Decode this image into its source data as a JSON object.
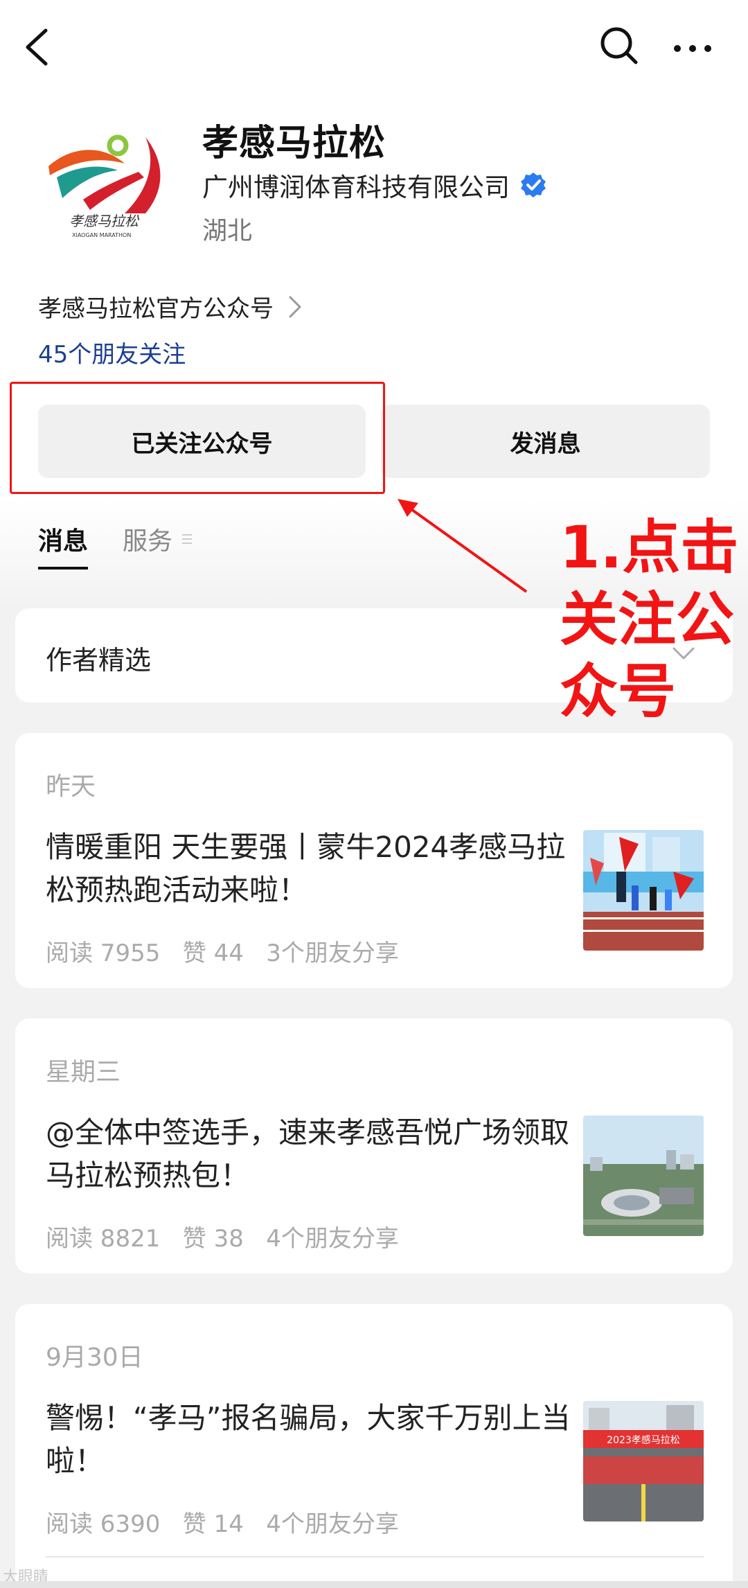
{
  "account": {
    "name": "孝感马拉松",
    "company": "广州博润体育科技有限公司",
    "region": "湖北",
    "description": "孝感马拉松官方公众号",
    "friends_following": "45个朋友关注",
    "logo_text": "孝感马拉松",
    "logo_subtext": "XIAOGAN MARATHON"
  },
  "buttons": {
    "follow_label": "已关注公众号",
    "message_label": "发消息"
  },
  "tabs": [
    {
      "label": "消息",
      "active": true
    },
    {
      "label": "服务",
      "active": false
    }
  ],
  "author_section": {
    "label": "作者精选"
  },
  "annotation": {
    "text": "1.点击关注公众号",
    "color": "#f21414"
  },
  "articles": [
    {
      "date": "昨天",
      "title": "情暖重阳 天生要强丨蒙牛2024孝感马拉松预热跑活动来啦！",
      "meta": "阅读 7955   赞 44   3个朋友分享",
      "thumb": "runners-with-flags"
    },
    {
      "date": "星期三",
      "title": "@全体中签选手，速来孝感吾悦广场领取马拉松预热包！",
      "meta": "阅读 8821   赞 38   4个朋友分享",
      "thumb": "aerial-city-view"
    },
    {
      "date": "9月30日",
      "title": "警惕！“孝马”报名骗局，大家千万别上当啦！",
      "meta": "阅读 6390   赞 14   4个朋友分享",
      "thumb": "marathon-start-line",
      "thumb_banner": "2023孝感马拉松"
    }
  ],
  "watermark": "大眼睛",
  "colors": {
    "link": "#1b3f8f",
    "verified": "#2b7cf0",
    "annotation_red": "#f21414"
  }
}
